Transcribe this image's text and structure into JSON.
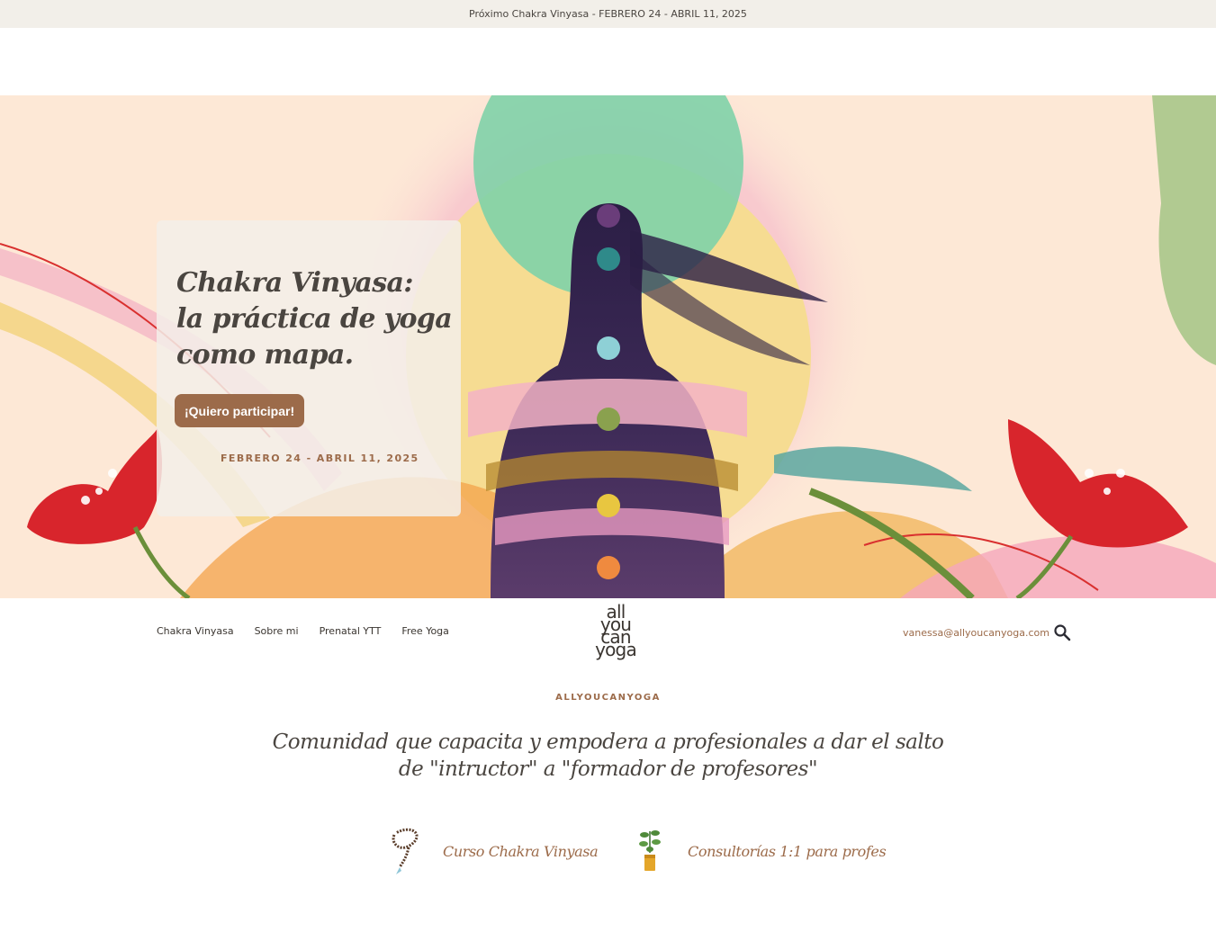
{
  "announcement": "Próximo Chakra Vinyasa -  FEBRERO 24 - ABRIL 11, 2025",
  "hero": {
    "title_lines": [
      "Chakra Vinyasa:",
      "la práctica de yoga",
      "como mapa."
    ],
    "button_label": "¡Quiero participar!",
    "dates": "FEBRERO 24 - ABRIL 11, 2025"
  },
  "nav": {
    "links": [
      "Chakra Vinyasa",
      "Sobre mi",
      "Prenatal YTT",
      "Free Yoga"
    ],
    "logo_lines": [
      "all",
      "you",
      "can",
      "yoga"
    ],
    "email": "vanessa@allyoucanyoga.com",
    "search_icon": "search-icon"
  },
  "intro": {
    "kicker": "ALLYOUCANYOGA",
    "tagline": "Comunidad que capacita y empodera a profesionales a dar el salto de \"intructor\" a \"formador de profesores\""
  },
  "ctas": [
    {
      "label": "Curso Chakra Vinyasa",
      "icon": "mala-beads-icon"
    },
    {
      "label": "Consultorías 1:1 para profes",
      "icon": "potted-plant-icon"
    }
  ],
  "colors": {
    "accent": "#9c6b4a",
    "announcement_bg": "#f2efe9",
    "hero_bg": "#fde8d6",
    "text": "#3a3530"
  }
}
